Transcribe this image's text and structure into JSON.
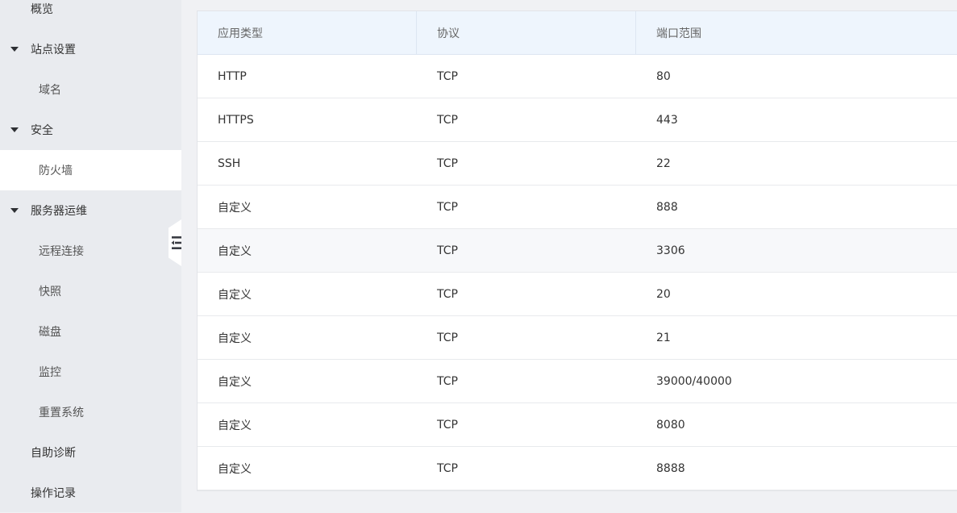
{
  "sidebar": {
    "items": [
      {
        "label": "概览",
        "level": 1
      },
      {
        "label": "站点设置",
        "level": 1,
        "expandable": true
      },
      {
        "label": "域名",
        "level": 2
      },
      {
        "label": "安全",
        "level": 1,
        "expandable": true
      },
      {
        "label": "防火墙",
        "level": 2,
        "active": true
      },
      {
        "label": "服务器运维",
        "level": 1,
        "expandable": true
      },
      {
        "label": "远程连接",
        "level": 2
      },
      {
        "label": "快照",
        "level": 2
      },
      {
        "label": "磁盘",
        "level": 2
      },
      {
        "label": "监控",
        "level": 2
      },
      {
        "label": "重置系统",
        "level": 2
      },
      {
        "label": "自助诊断",
        "level": 1
      },
      {
        "label": "操作记录",
        "level": 1
      }
    ]
  },
  "table": {
    "headers": [
      "应用类型",
      "协议",
      "端口范围"
    ],
    "rows": [
      [
        "HTTP",
        "TCP",
        "80"
      ],
      [
        "HTTPS",
        "TCP",
        "443"
      ],
      [
        "SSH",
        "TCP",
        "22"
      ],
      [
        "自定义",
        "TCP",
        "888"
      ],
      [
        "自定义",
        "TCP",
        "3306"
      ],
      [
        "自定义",
        "TCP",
        "20"
      ],
      [
        "自定义",
        "TCP",
        "21"
      ],
      [
        "自定义",
        "TCP",
        "39000/40000"
      ],
      [
        "自定义",
        "TCP",
        "8080"
      ],
      [
        "自定义",
        "TCP",
        "8888"
      ]
    ]
  },
  "colors": {
    "sidebar_bg": "#e9ebef",
    "active_bg": "#ffffff",
    "header_bg": "#eef5fd",
    "hover_row_bg": "#f7f8fa"
  }
}
